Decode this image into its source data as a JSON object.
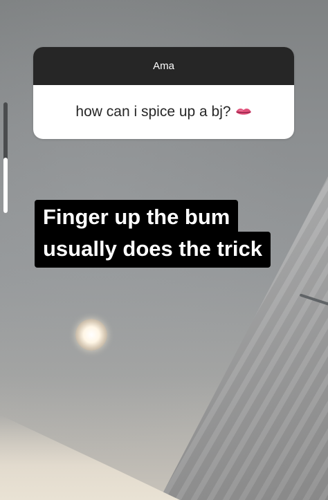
{
  "story": {
    "progress": 0.5
  },
  "question_sticker": {
    "header": "Ama",
    "question": "how can i spice up a bj?",
    "emoji": "lips-emoji"
  },
  "answer": {
    "lines": [
      "Finger up the bum",
      "usually does the trick"
    ]
  },
  "colors": {
    "sticker_header_bg": "#262626",
    "sticker_body_bg": "#ffffff",
    "answer_bg": "#000000",
    "answer_text": "#ffffff"
  }
}
